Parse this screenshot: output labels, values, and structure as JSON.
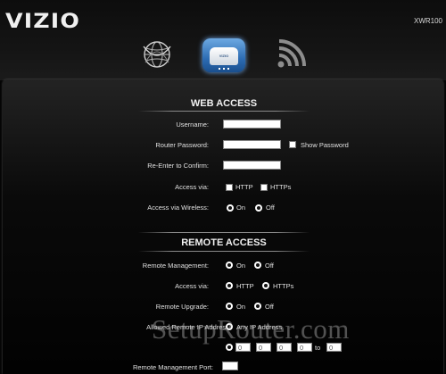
{
  "header": {
    "brand": "VIZIO",
    "model": "XWR100",
    "nav_icons": [
      "globe-icon",
      "router-icon",
      "wireless-icon"
    ],
    "router_label": "VIZIO"
  },
  "web_access": {
    "title": "WEB ACCESS",
    "username_label": "Username:",
    "router_password_label": "Router Password:",
    "show_password_label": "Show Password",
    "reenter_label": "Re-Enter to Confirm:",
    "access_via_label": "Access via:",
    "access_options": [
      "HTTP",
      "HTTPs"
    ],
    "wireless_label": "Access via Wireless:",
    "wireless_options": [
      "On",
      "Off"
    ]
  },
  "remote_access": {
    "title": "REMOTE ACCESS",
    "management_label": "Remote Management:",
    "management_options": [
      "On",
      "Off"
    ],
    "access_via_label": "Access via:",
    "access_options": [
      "HTTP",
      "HTTPs"
    ],
    "upgrade_label": "Remote Upgrade:",
    "upgrade_options": [
      "On",
      "Off"
    ],
    "allowed_ip_label": "Allowed Remote IP Address:",
    "any_ip_label": "Any IP Address",
    "ip_octets": [
      "0",
      "0",
      "0",
      "0",
      "0"
    ],
    "to_label": "to",
    "port_label": "Remote Management Port:"
  },
  "watermark": "SetupRouter.com"
}
